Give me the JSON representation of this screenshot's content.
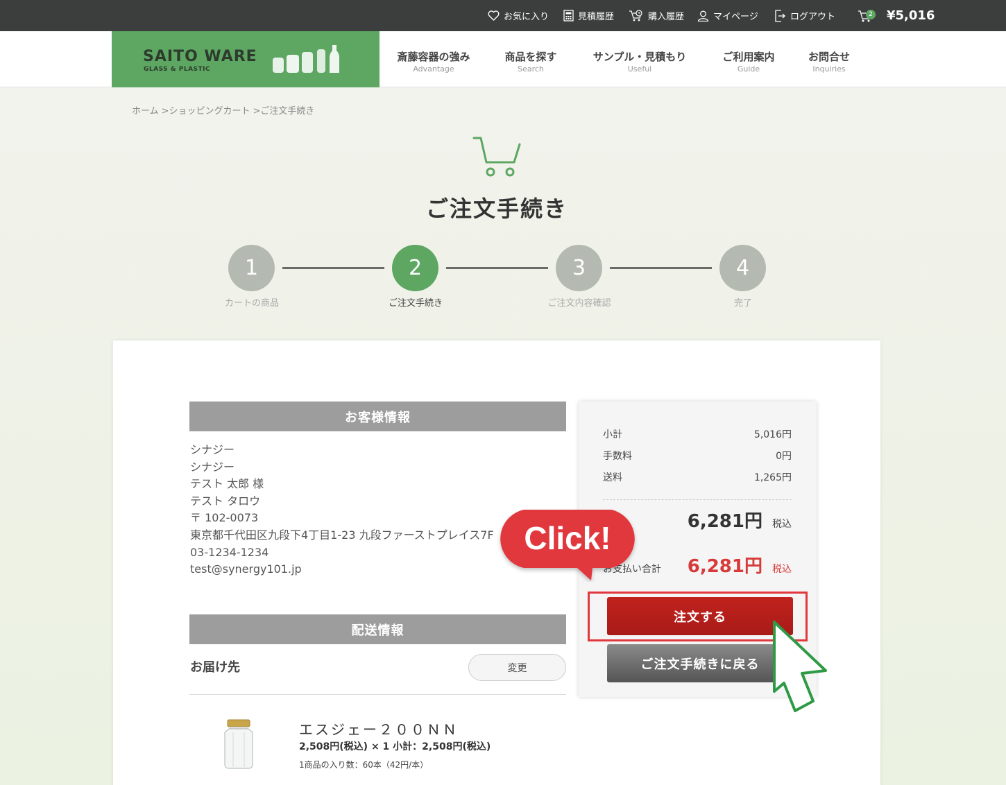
{
  "topbar": {
    "favorites": "お気に入り",
    "quote_history": "見積履歴",
    "purchase_history": "購入履歴",
    "mypage": "マイページ",
    "logout": "ログアウト",
    "cart_count": "2",
    "cart_total": "¥5,016"
  },
  "logo": {
    "brand": "SAITO WARE",
    "sub": "GLASS & PLASTIC"
  },
  "nav": [
    {
      "ja": "斎藤容器の強み",
      "en": "Advantage"
    },
    {
      "ja": "商品を探す",
      "en": "Search"
    },
    {
      "ja": "サンプル・見積もり",
      "en": "Useful"
    },
    {
      "ja": "ご利用案内",
      "en": "Guide"
    },
    {
      "ja": "お問合せ",
      "en": "Inquiries"
    }
  ],
  "breadcrumb": [
    "ホーム",
    ">ショッピングカート",
    ">ご注文手続き"
  ],
  "page_title": "ご注文手続き",
  "steps": [
    {
      "num": "1",
      "label": "カートの商品"
    },
    {
      "num": "2",
      "label": "ご注文手続き"
    },
    {
      "num": "3",
      "label": "ご注文内容確認"
    },
    {
      "num": "4",
      "label": "完了"
    }
  ],
  "customer": {
    "heading": "お客様情報",
    "lines": [
      "シナジー",
      "シナジー",
      "テスト 太郎 様",
      "テスト タロウ",
      "〒 102-0073",
      "東京都千代田区九段下4丁目1-23 九段ファーストプレイス7F",
      "03-1234-1234",
      "test@synergy101.jp"
    ]
  },
  "delivery": {
    "heading": "配送情報",
    "destination_label": "お届け先",
    "change_button": "変更"
  },
  "product": {
    "name": "エスジェー２００ＮＮ",
    "price_line": "2,508円(税込) × 1  小計：2,508円(税込)",
    "qty_line": "1商品の入り数：60本（42円/本）"
  },
  "summary": {
    "subtotal_label": "小計",
    "subtotal": "5,016円",
    "fee_label": "手数料",
    "fee": "0円",
    "shipping_label": "送料",
    "shipping": "1,265円",
    "total": "6,281円",
    "total_tax": "税込",
    "payment_label": "お支払い合計",
    "payment_total": "6,281円",
    "payment_tax": "税込"
  },
  "buttons": {
    "order": "注文する",
    "back": "ご注文手続きに戻る"
  },
  "callout": "Click!",
  "colors": {
    "brand_green": "#5ea763",
    "accent_red": "#d73a3a",
    "topbar": "#3c3e3d"
  }
}
